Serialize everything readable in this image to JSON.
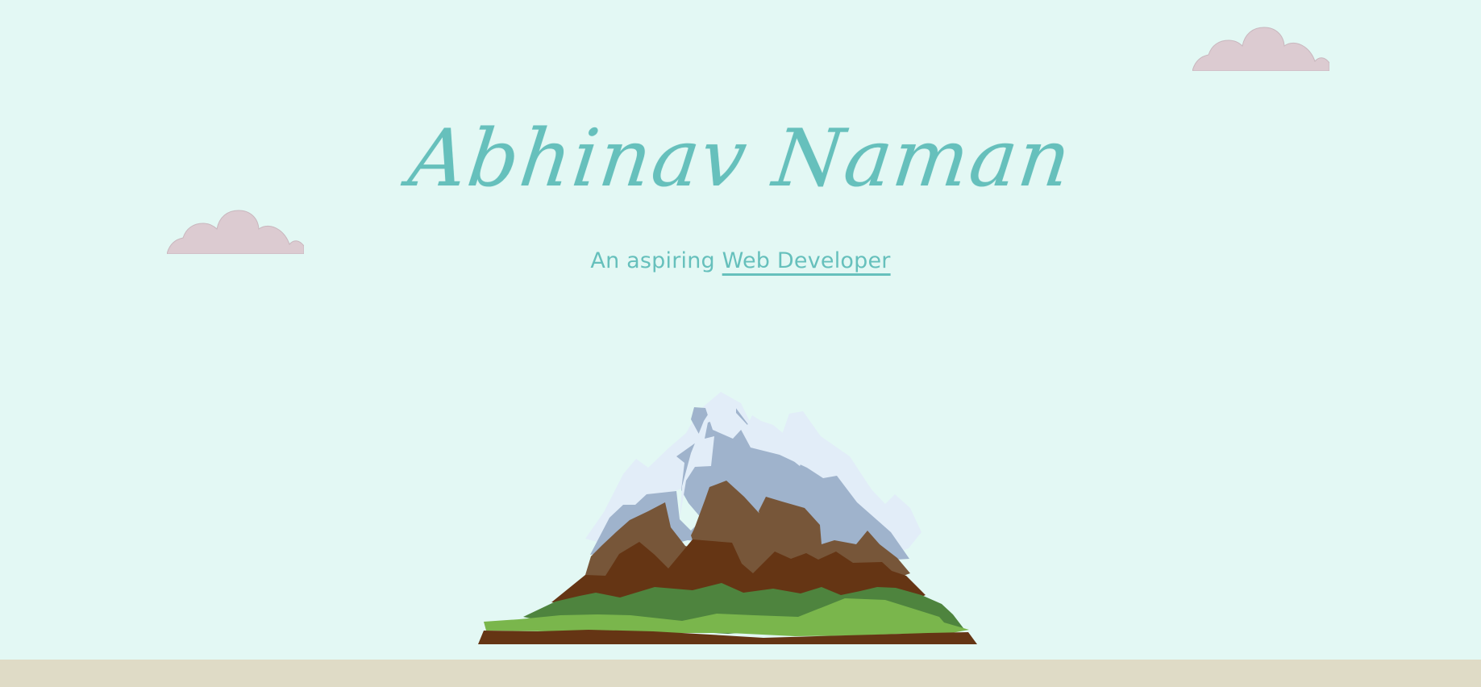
{
  "hero": {
    "name": "Abhinav Naman",
    "tagline_prefix": "An aspiring ",
    "tagline_role": "Web Developer"
  },
  "illustration": {
    "mountain_icon": "mountain-icon",
    "cloud_icon": "cloud-icon"
  },
  "colors": {
    "background": "#e3f8f4",
    "accent": "#66c0bc",
    "ground": "#dfdbc6",
    "cloud": "#dccbd1",
    "snow": "#e2edf8",
    "shadow_snow": "#9fb3cc",
    "rock_light": "#775639",
    "rock_dark": "#653514",
    "grass_dark": "#4e843e",
    "grass_light": "#7ab64c"
  }
}
